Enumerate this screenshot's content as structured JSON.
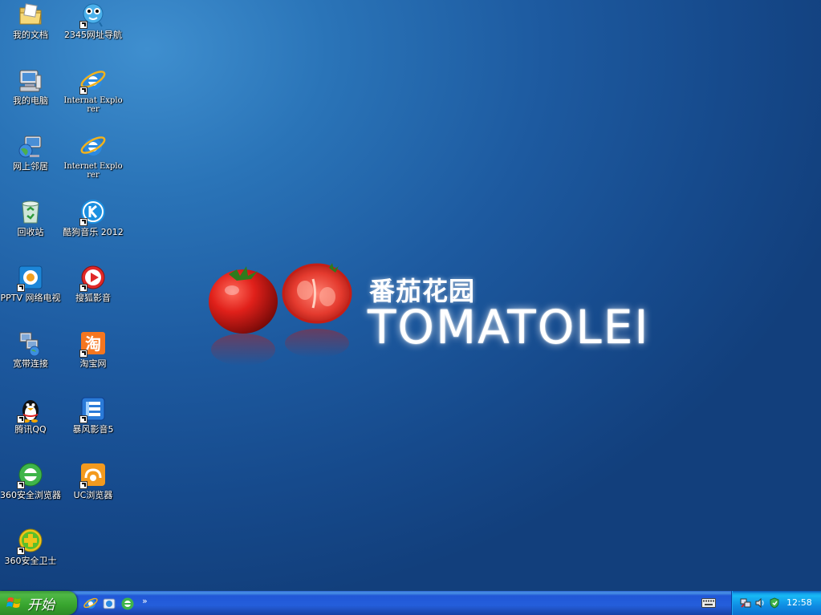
{
  "desktop": {
    "icons": [
      {
        "label": "我的文档"
      },
      {
        "label": "2345网址导航"
      },
      {
        "label": "我的电脑"
      },
      {
        "label": "Internat Explorer"
      },
      {
        "label": "网上邻居"
      },
      {
        "label": "Internet Explorer"
      },
      {
        "label": "回收站"
      },
      {
        "label": "酷狗音乐 2012"
      },
      {
        "label": "PPTV 网络电视"
      },
      {
        "label": "搜狐影音"
      },
      {
        "label": "宽带连接"
      },
      {
        "label": "淘宝网"
      },
      {
        "label": "腾讯QQ"
      },
      {
        "label": "暴风影音5"
      },
      {
        "label": "360安全浏览器"
      },
      {
        "label": "UC浏览器"
      },
      {
        "label": "360安全卫士"
      }
    ]
  },
  "wallpaper": {
    "title_cn": "番茄花园",
    "title_en": "TOMATOLEI"
  },
  "taskbar": {
    "start_label": "开始",
    "quicklaunch_more": "»",
    "clock": "12:58"
  },
  "colors": {
    "desktop": "#1d5aa0",
    "taskbar": "#245edb",
    "start_button": "#37a42e",
    "tray": "#0f8ee4"
  }
}
